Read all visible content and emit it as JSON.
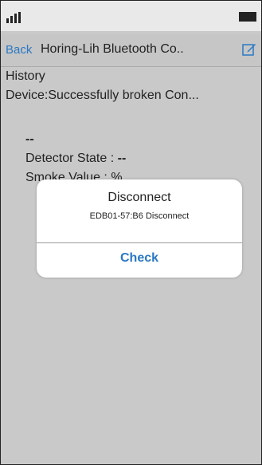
{
  "nav": {
    "back_label": "Back",
    "title": "Horing-Lih Bluetooth Co.."
  },
  "content": {
    "history_label": "History",
    "device_status": "Device:Successfully broken Con...",
    "dash": "--",
    "detector_state_label": "Detector State : ",
    "detector_state_value": "--",
    "smoke_value_label": "Smoke Value :   %"
  },
  "alert": {
    "title": "Disconnect",
    "message": "EDB01-57:B6 Disconnect",
    "button_label": "Check"
  },
  "icons": {
    "signal": "signal-bars-icon",
    "battery": "battery-icon",
    "edit": "edit-icon"
  },
  "colors": {
    "accent": "#2a78c4",
    "background": "#c9c9c9"
  }
}
